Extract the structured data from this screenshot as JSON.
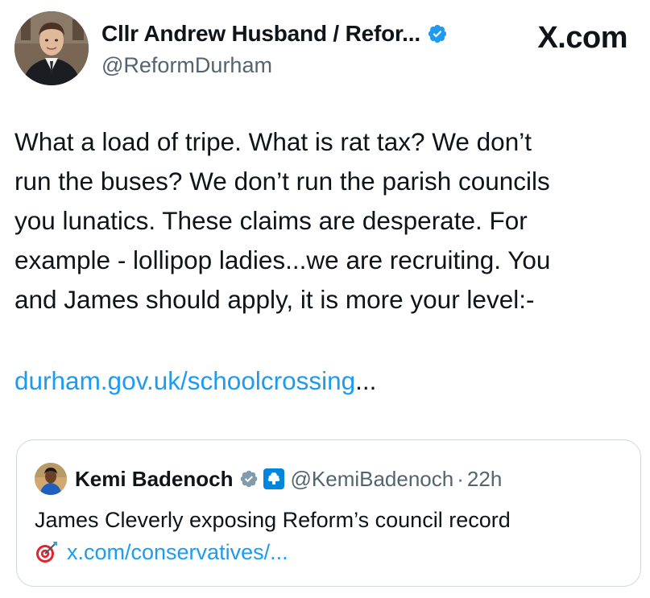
{
  "colors": {
    "text": "#0f1419",
    "secondary_text": "#536471",
    "link": "#1d9bf0",
    "verified_badge": "#1d9bf0",
    "affiliation_badge": "#0087dc",
    "card_border": "#cfd9de"
  },
  "author": {
    "display_name": "Cllr Andrew Husband / Refor...",
    "handle": "@ReformDurham",
    "avatar_icon": "profile-photo",
    "verified_icon": "verified-badge-icon"
  },
  "site": {
    "label": "X.com"
  },
  "tweet": {
    "text": "What a load of tripe. What is rat tax? We don’t\nrun the buses? We don’t run the parish councils\nyou lunatics. These claims are desperate. For\nexample - lollipop ladies...we are recruiting. You\nand James should apply, it is more your level:-",
    "link": "durham.gov.uk/schoolcrossing",
    "link_ellipsis": "..."
  },
  "quote": {
    "display_name": "Kemi Badenoch",
    "handle": "@KemiBadenoch",
    "separator": "·",
    "time": "22h",
    "text": "James Cleverly exposing Reform’s council record",
    "link": "x.com/conservatives/...",
    "verified_icon": "grey-verified-badge-icon",
    "affiliation_icon": "conservative-tree-badge-icon",
    "link_icon": "direct-hit-dart-icon"
  }
}
